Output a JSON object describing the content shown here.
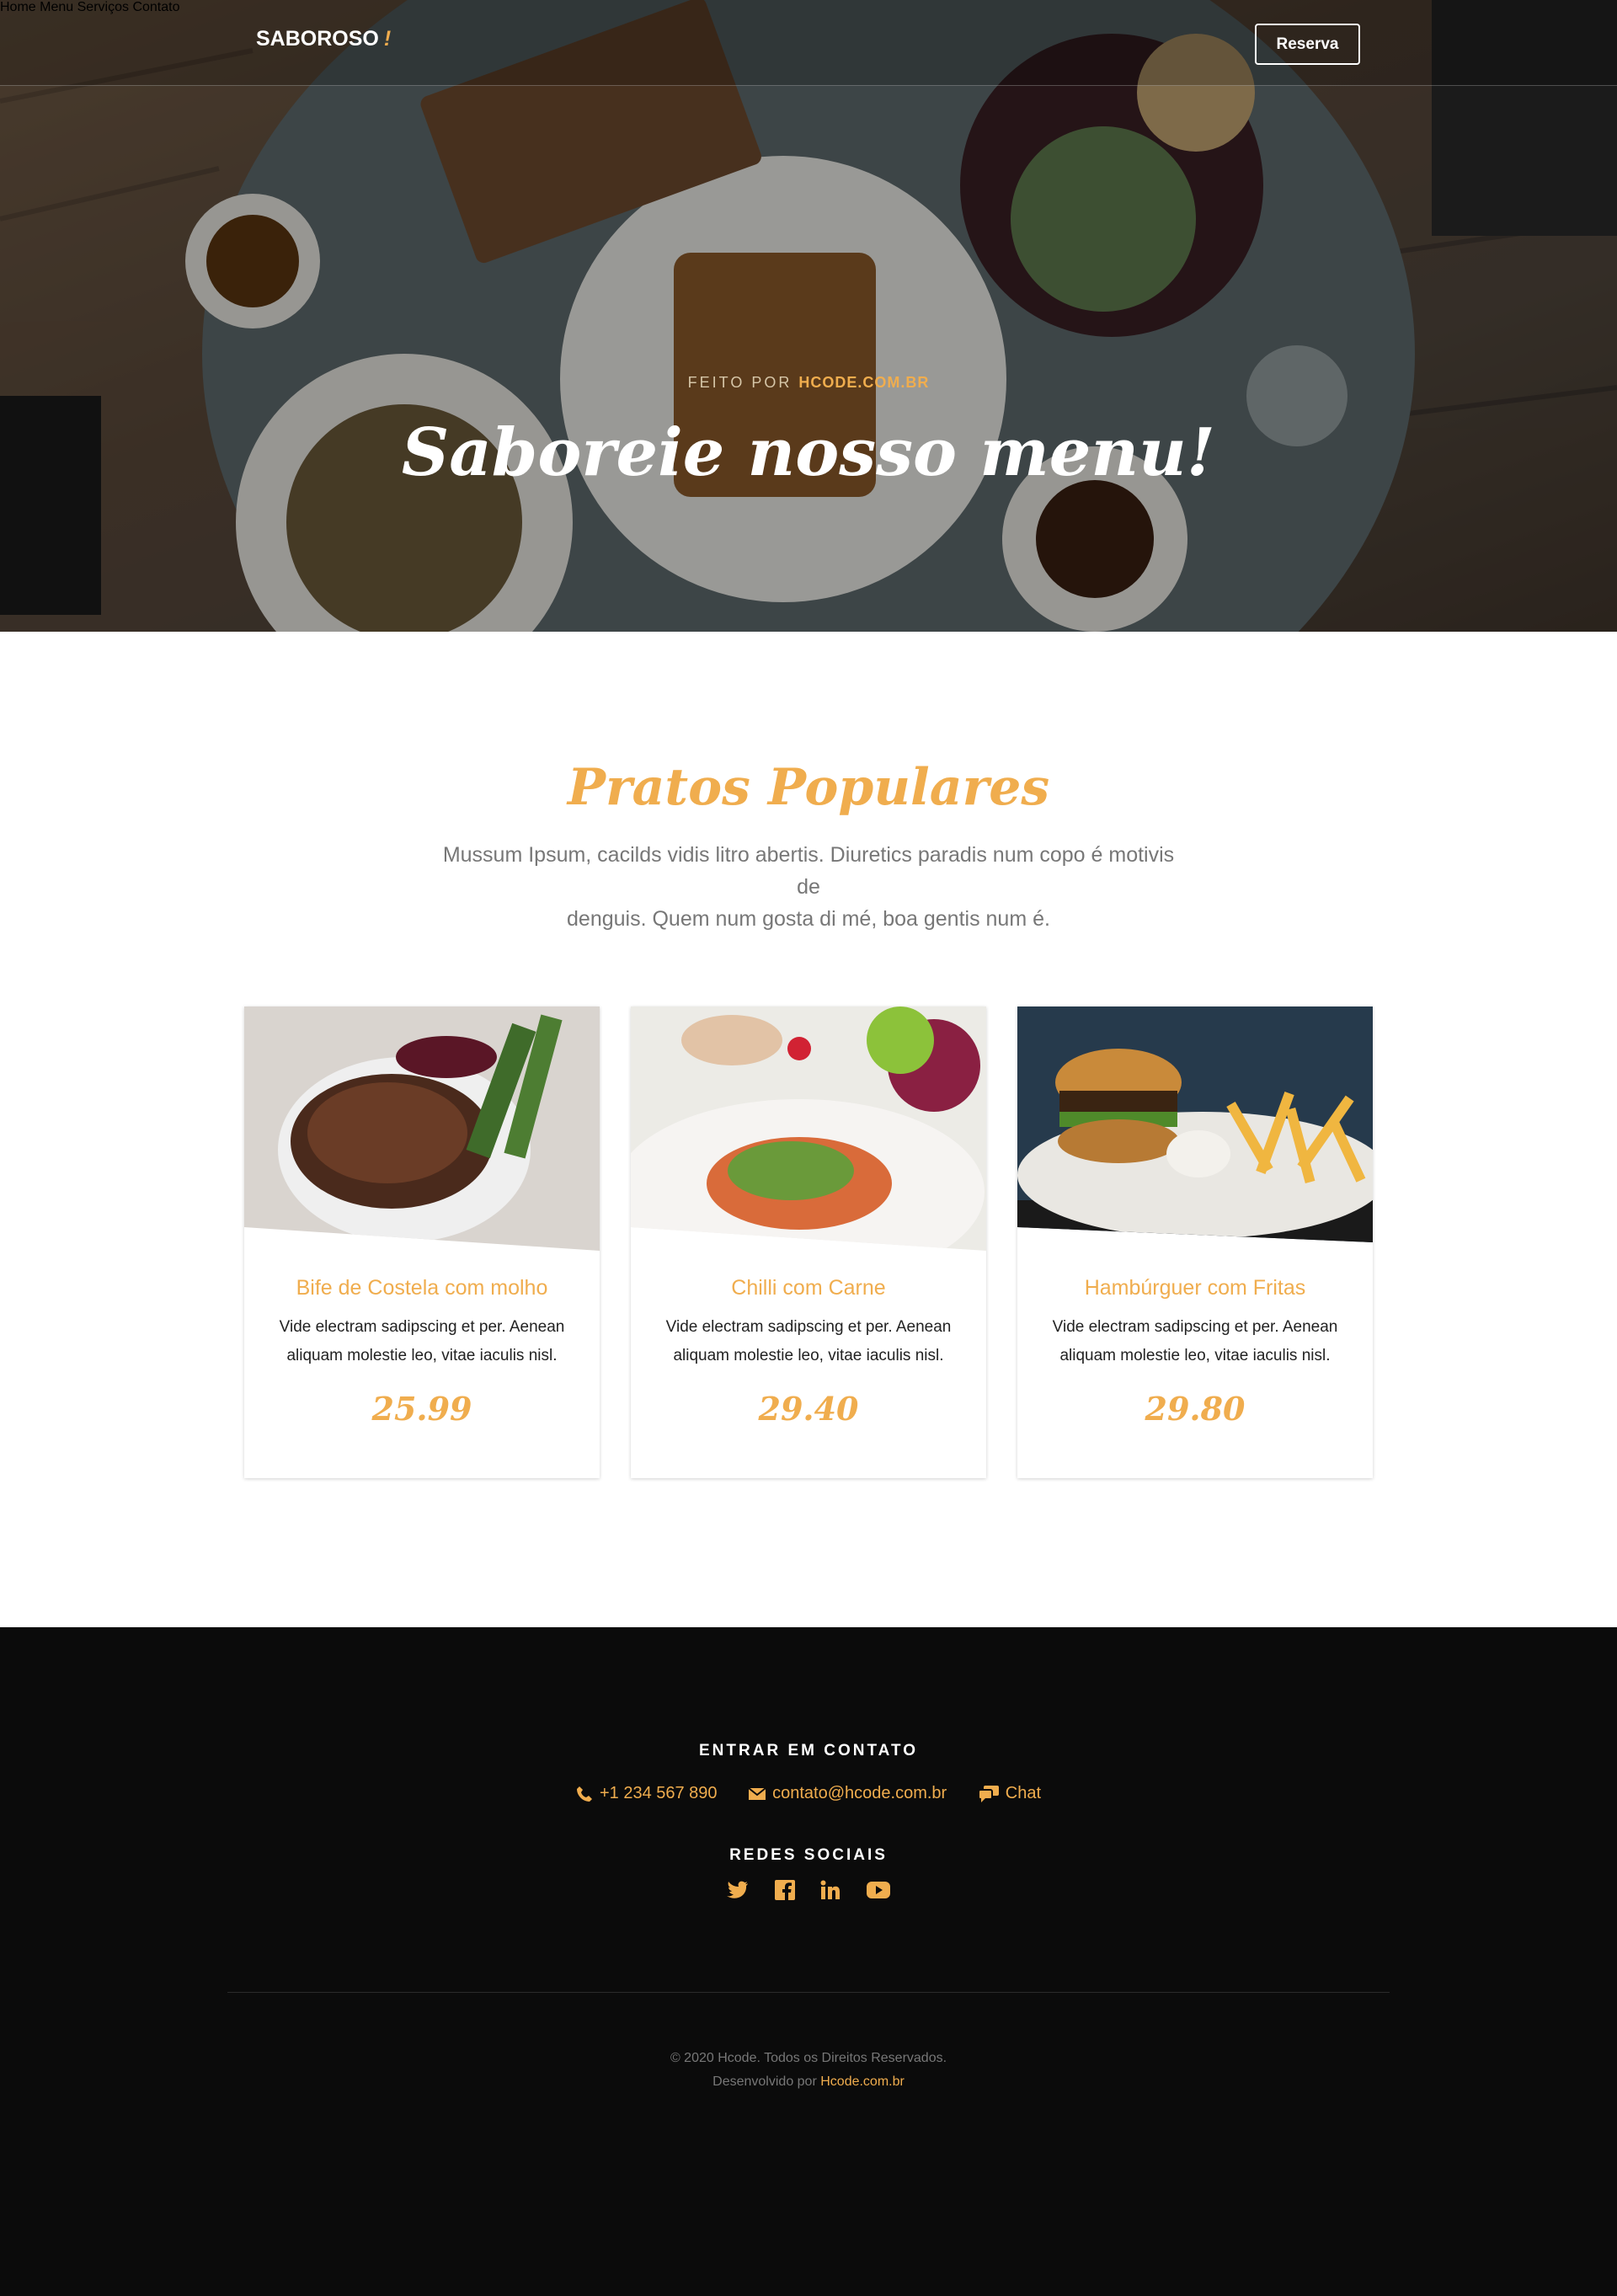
{
  "brand": {
    "name": "SABOROSO",
    "mark": "!"
  },
  "nav": {
    "items": [
      "Home",
      "Menu",
      "Serviços",
      "Contato"
    ],
    "cta": "Reserva"
  },
  "hero": {
    "subtitle_prefix": "FEITO POR",
    "subtitle_highlight": "HCODE.COM.BR",
    "title": "Saboreie nosso menu!"
  },
  "section": {
    "title": "Pratos Populares",
    "text_line1": "Mussum Ipsum, cacilds vidis litro abertis. Diuretics paradis num copo é motivis de",
    "text_line2": "denguis. Quem num gosta di mé, boa gentis num é."
  },
  "dishes": [
    {
      "name": "Bife de Costela com molho",
      "desc_line1": "Vide electram sadipscing et per. Aenean",
      "desc_line2": "aliquam molestie leo, vitae iaculis nisl.",
      "price": "25.99",
      "image": "steak-photo"
    },
    {
      "name": "Chilli com Carne",
      "desc_line1": "Vide electram sadipscing et per. Aenean",
      "desc_line2": "aliquam molestie leo, vitae iaculis nisl.",
      "price": "29.40",
      "image": "salad-photo"
    },
    {
      "name": "Hambúrguer com Fritas",
      "desc_line1": "Vide electram sadipscing et per. Aenean",
      "desc_line2": "aliquam molestie leo, vitae iaculis nisl.",
      "price": "29.80",
      "image": "burger-photo"
    }
  ],
  "footer": {
    "contact_heading": "ENTRAR EM CONTATO",
    "phone": "+1 234 567 890",
    "email": "contato@hcode.com.br",
    "chat": "Chat",
    "social_heading": "REDES SOCIAIS",
    "social_icons": [
      "twitter-icon",
      "facebook-icon",
      "linkedin-icon",
      "youtube-icon"
    ],
    "copyright": "© 2020 Hcode. Todos os Direitos Reservados.",
    "developed_prefix": "Desenvolvido por",
    "developed_link": "Hcode.com.br"
  },
  "colors": {
    "accent": "#f0ad4e",
    "footer_bg": "#0b0b0b",
    "text_muted": "#777777"
  }
}
